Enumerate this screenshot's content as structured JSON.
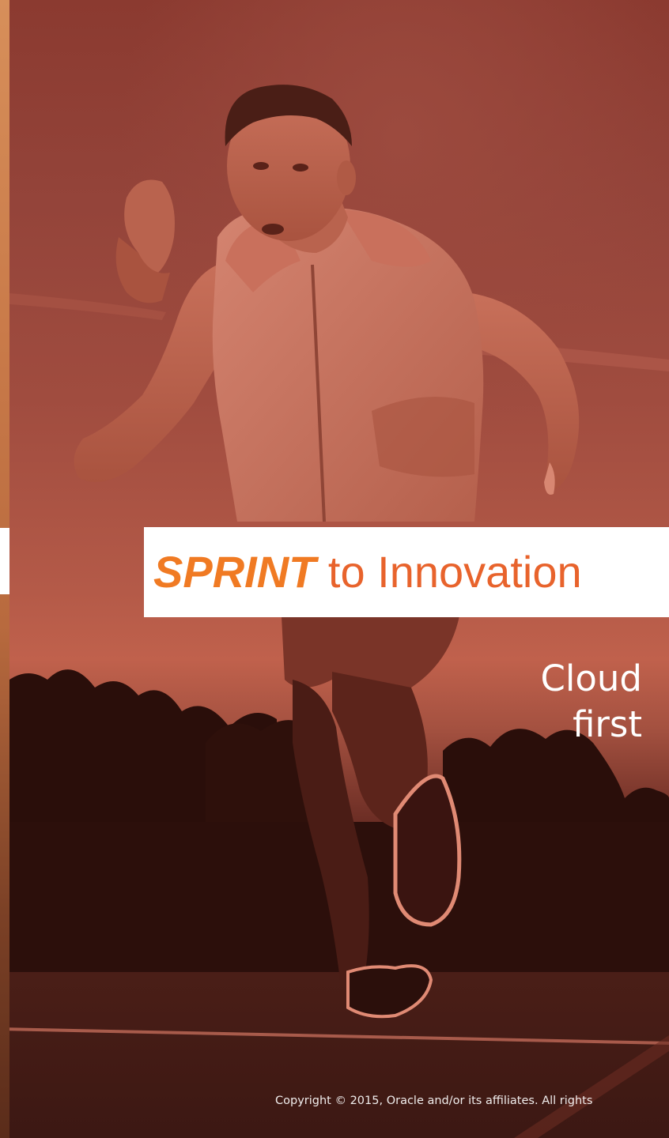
{
  "slide": {
    "title": {
      "emphasis": "SPRINT",
      "rest": " to Innovation"
    },
    "subtitle": {
      "line1": "Cloud",
      "line2": "first"
    },
    "copyright": "Copyright © 2015, Oracle and/or its affiliates. All rights",
    "colors": {
      "title_orange": "#f07a23",
      "tint": "#b45a48"
    }
  }
}
